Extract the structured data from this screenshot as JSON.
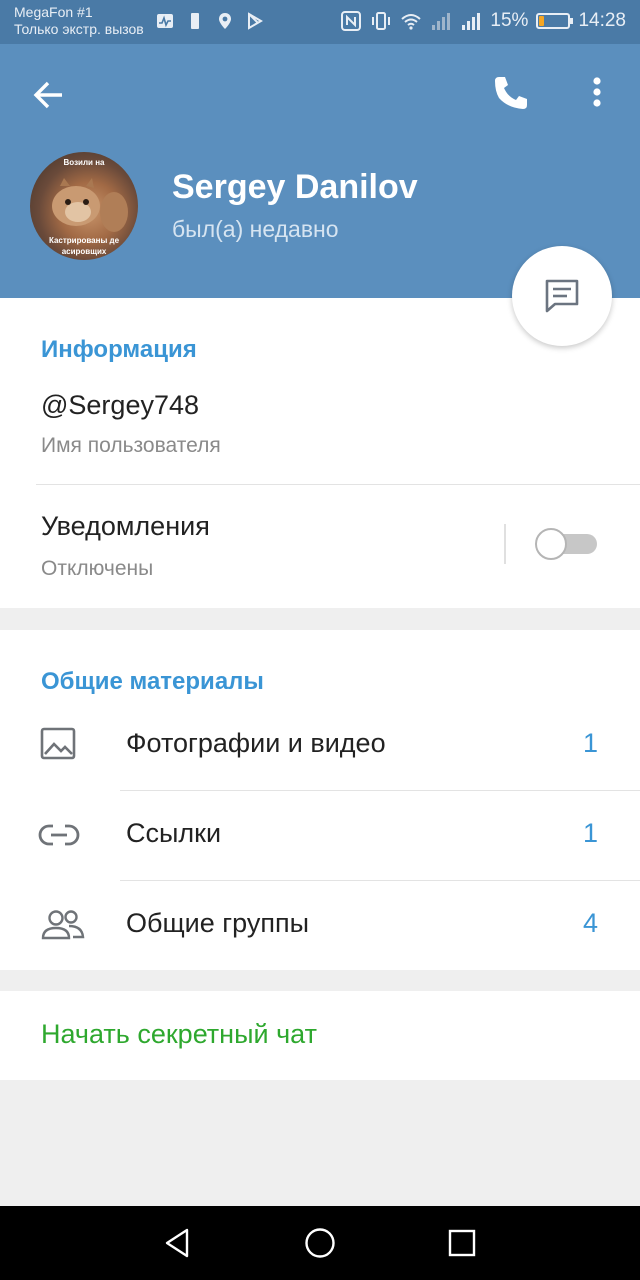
{
  "status_bar": {
    "carrier": "MegaFon #1",
    "carrier_sub": "Только экстр. вызов",
    "battery_percent": "15%",
    "battery_level": 0.15,
    "time": "14:28",
    "battery_color": "#f5a623"
  },
  "header": {
    "name": "Sergey Danilov",
    "last_seen": "был(а) недавно",
    "avatar_caption_top": "Возили на",
    "avatar_caption_bottom": "Кастрированы де",
    "avatar_caption_bottom2": "асировщих",
    "background_color": "#5b8fbe",
    "icons": [
      "back-arrow-icon",
      "phone-icon",
      "more-vertical-icon",
      "message-icon"
    ]
  },
  "info": {
    "title": "Информация",
    "username": "@Sergey748",
    "username_label": "Имя пользователя",
    "notifications_label": "Уведомления",
    "notifications_state": "Отключены",
    "notifications_on": false
  },
  "shared": {
    "title": "Общие материалы",
    "items": [
      {
        "icon": "image-icon",
        "label": "Фотографии и видео",
        "count": "1"
      },
      {
        "icon": "link-icon",
        "label": "Ссылки",
        "count": "1"
      },
      {
        "icon": "groups-icon",
        "label": "Общие группы",
        "count": "4"
      }
    ]
  },
  "secret_chat": {
    "label": "Начать секретный чат",
    "color": "#2ea82e"
  },
  "nav": [
    "back-triangle-icon",
    "home-circle-icon",
    "recents-square-icon"
  ]
}
